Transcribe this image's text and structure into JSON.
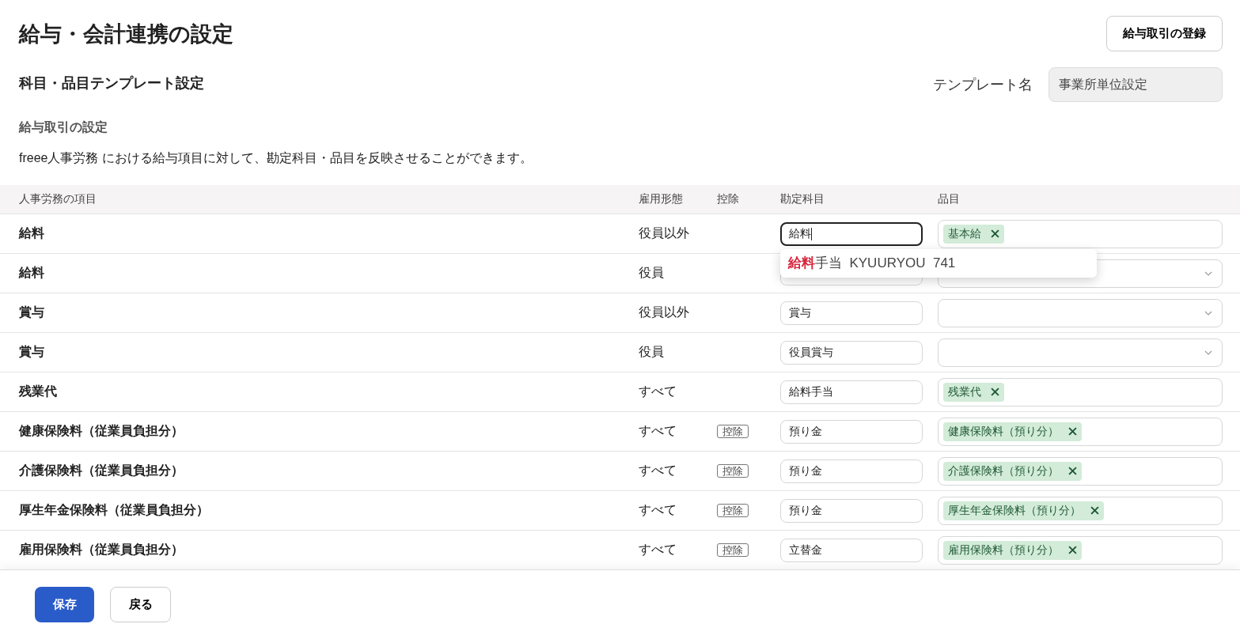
{
  "title": "給与・会計連携の設定",
  "register_button": "給与取引の登録",
  "subtitle": "科目・品目テンプレート設定",
  "template": {
    "label": "テンプレート名",
    "value": "事業所単位設定"
  },
  "section": {
    "heading": "給与取引の設定",
    "description": "freee人事労務 における給与項目に対して、勘定科目・品目を反映させることができます。"
  },
  "columns": [
    "人事労務の項目",
    "雇用形態",
    "控除",
    "勘定科目",
    "品目"
  ],
  "rows": [
    {
      "name": "給料",
      "employment": "役員以外",
      "account": "給料",
      "focused": true,
      "items": [
        "基本給"
      ]
    },
    {
      "name": "給料",
      "employment": "役員",
      "focused": false,
      "items": []
    },
    {
      "name": "賞与",
      "employment": "役員以外",
      "account": "賞与",
      "focused": false,
      "items": []
    },
    {
      "name": "賞与",
      "employment": "役員",
      "account": "役員賞与",
      "focused": false,
      "items": []
    },
    {
      "name": "残業代",
      "employment": "すべて",
      "account": "給料手当",
      "focused": false,
      "items": [
        "残業代"
      ]
    },
    {
      "name": "健康保険料（従業員負担分）",
      "employment": "すべて",
      "deduction": "控除",
      "account": "預り金",
      "focused": false,
      "items": [
        "健康保険料（預り分）"
      ]
    },
    {
      "name": "介護保険料（従業員負担分）",
      "employment": "すべて",
      "deduction": "控除",
      "account": "預り金",
      "focused": false,
      "items": [
        "介護保険料（預り分）"
      ]
    },
    {
      "name": "厚生年金保険料（従業員負担分）",
      "employment": "すべて",
      "deduction": "控除",
      "account": "預り金",
      "focused": false,
      "items": [
        "厚生年金保険料（預り分）"
      ]
    },
    {
      "name": "雇用保険料（従業員負担分）",
      "employment": "すべて",
      "deduction": "控除",
      "account": "立替金",
      "focused": false,
      "items": [
        "雇用保険料（預り分）"
      ]
    }
  ],
  "suggestion": {
    "match": "給料",
    "rest": "手当",
    "code": "KYUURYOU",
    "number": "741"
  },
  "buttons": {
    "save": "保存",
    "back": "戻る"
  }
}
